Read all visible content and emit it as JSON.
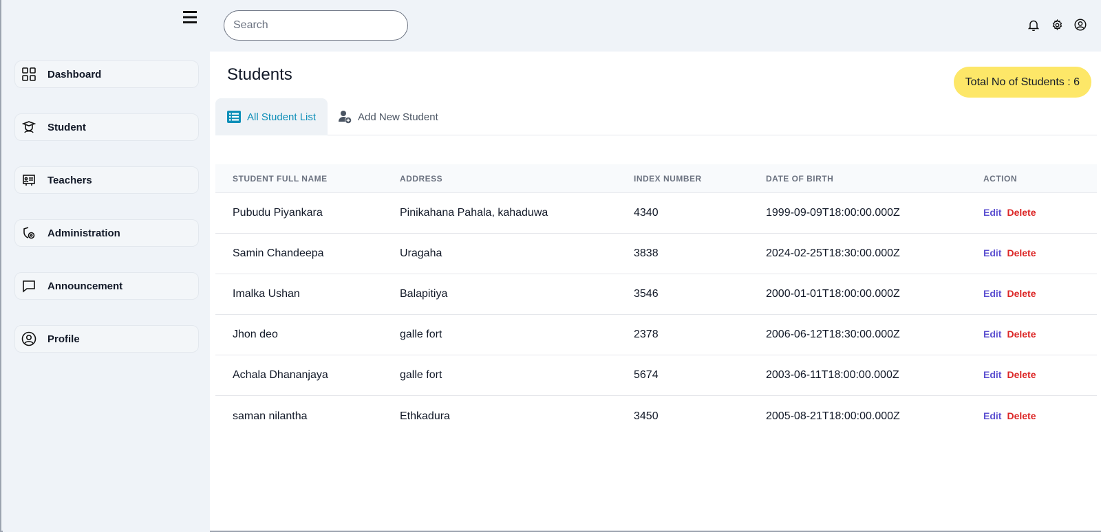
{
  "search": {
    "placeholder": "Search",
    "value": ""
  },
  "sidebar": {
    "items": [
      {
        "label": "Dashboard",
        "icon": "dashboard-grid-icon"
      },
      {
        "label": "Student",
        "icon": "student-graduate-icon"
      },
      {
        "label": "Teachers",
        "icon": "teacher-board-icon"
      },
      {
        "label": "Administration",
        "icon": "administration-shield-icon"
      },
      {
        "label": "Announcement",
        "icon": "chat-bubble-icon"
      },
      {
        "label": "Profile",
        "icon": "user-circle-icon"
      }
    ]
  },
  "topbar": {
    "icons": [
      "bell-icon",
      "gear-icon",
      "user-circle-icon"
    ]
  },
  "main": {
    "title": "Students",
    "total_badge": "Total No of Students : 6",
    "tabs": [
      {
        "label": "All Student List",
        "icon": "list-icon",
        "active": true
      },
      {
        "label": "Add New Student",
        "icon": "add-user-icon",
        "active": false
      }
    ]
  },
  "table": {
    "headers": [
      "STUDENT FULL NAME",
      "ADDRESS",
      "INDEX NUMBER",
      "DATE OF BIRTH",
      "ACTION"
    ],
    "edit_label": "Edit",
    "delete_label": "Delete",
    "rows": [
      {
        "name": "Pubudu Piyankara",
        "address": "Pinikahana Pahala, kahaduwa",
        "index": "4340",
        "dob": "1999-09-09T18:00:00.000Z"
      },
      {
        "name": "Samin Chandeepa",
        "address": "Uragaha",
        "index": "3838",
        "dob": "2024-02-25T18:30:00.000Z"
      },
      {
        "name": "Imalka Ushan",
        "address": "Balapitiya",
        "index": "3546",
        "dob": "2000-01-01T18:00:00.000Z"
      },
      {
        "name": "Jhon deo",
        "address": "galle fort",
        "index": "2378",
        "dob": "2006-06-12T18:30:00.000Z"
      },
      {
        "name": "Achala Dhananjaya",
        "address": "galle fort",
        "index": "5674",
        "dob": "2003-06-11T18:00:00.000Z"
      },
      {
        "name": "saman nilantha",
        "address": "Ethkadura",
        "index": "3450",
        "dob": "2005-08-21T18:00:00.000Z"
      }
    ]
  },
  "colors": {
    "accent": "#0e8fb8",
    "badge": "#fde768",
    "edit": "#5b4fd0",
    "delete": "#dc2626"
  }
}
